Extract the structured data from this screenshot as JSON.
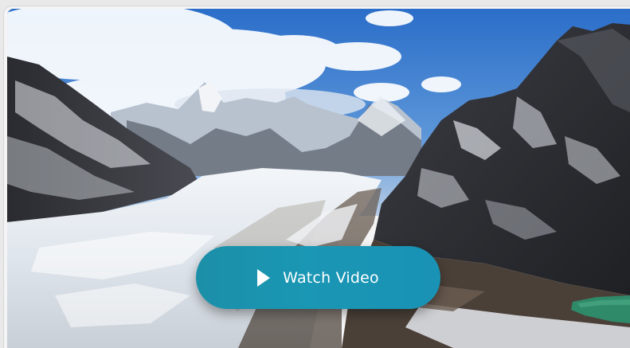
{
  "video": {
    "button_label": "Watch Video",
    "icon": "play-icon",
    "button_color": "#1a93b0"
  },
  "colors": {
    "sky": "#3a7fd0",
    "snow": "#eef2f6",
    "rock": "#2a2c31",
    "lake": "#2f8a6a"
  }
}
